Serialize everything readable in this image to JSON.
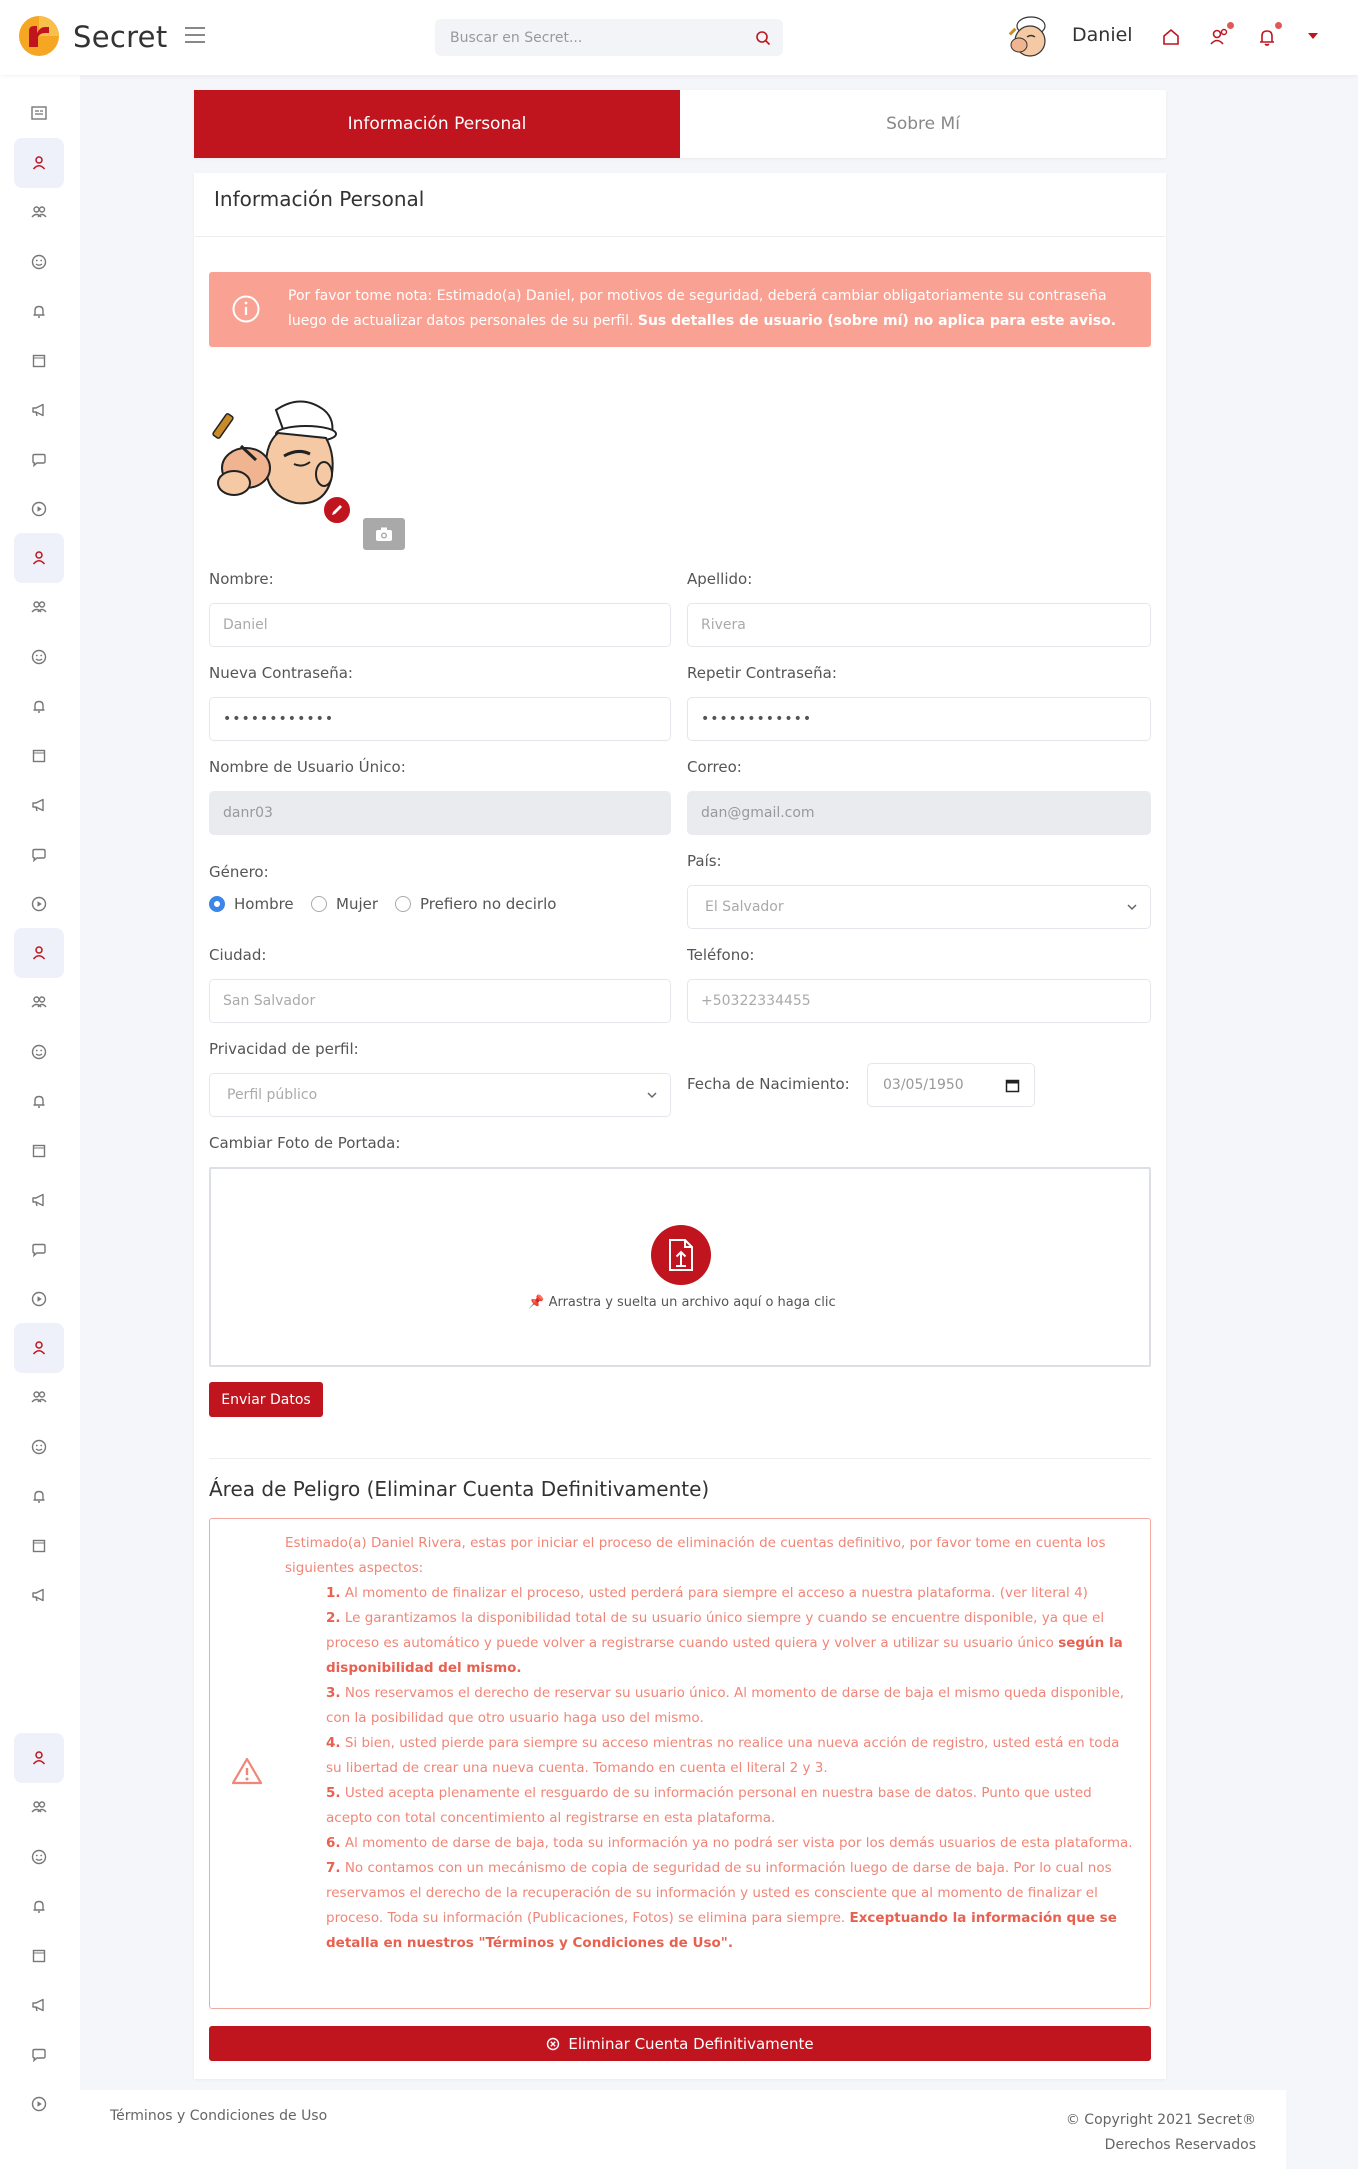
{
  "header": {
    "brand": "Secret",
    "search_placeholder": "Buscar en Secret...",
    "user_name": "Daniel"
  },
  "tabs": {
    "personal": "Información Personal",
    "about": "Sobre Mí"
  },
  "card": {
    "title": "Información Personal"
  },
  "alert": {
    "text": "Por favor tome nota: Estimado(a) Daniel, por motivos de seguridad, deberá cambiar obligatoriamente su contraseña luego de actualizar datos personales de su perfil.",
    "bold": "Sus detalles de usuario (sobre mí) no aplica para este aviso."
  },
  "form": {
    "nombre_label": "Nombre:",
    "nombre_value": "Daniel",
    "apellido_label": "Apellido:",
    "apellido_value": "Rivera",
    "nueva_pass_label": "Nueva Contraseña:",
    "nueva_pass_value": "••••••••••••",
    "repetir_pass_label": "Repetir Contraseña:",
    "repetir_pass_value": "••••••••••••",
    "usuario_label": "Nombre de Usuario Único:",
    "usuario_value": "danr03",
    "correo_label": "Correo:",
    "correo_value": "dan@gmail.com",
    "genero_label": "Género:",
    "genero_options": [
      "Hombre",
      "Mujer",
      "Prefiero no decirlo"
    ],
    "pais_label": "País:",
    "pais_value": "El Salvador",
    "ciudad_label": "Ciudad:",
    "ciudad_value": "San Salvador",
    "telefono_label": "Teléfono:",
    "telefono_value": "+50322334455",
    "privacidad_label": "Privacidad de perfil:",
    "privacidad_value": "Perfil público",
    "fecha_label": "Fecha de Nacimiento:",
    "fecha_value": "03/05/1950",
    "portada_label": "Cambiar Foto de Portada:",
    "dropzone_text": "Arrastra y suelta un archivo aquí o haga clic",
    "submit_label": "Enviar Datos"
  },
  "danger": {
    "title": "Área de Peligro (Eliminar Cuenta Definitivamente)",
    "intro": "Estimado(a) Daniel Rivera, estas por iniciar el proceso de eliminación de cuentas definitivo, por favor tome en cuenta los siguientes aspectos:",
    "items": [
      {
        "num": "1.",
        "text": "Al momento de finalizar el proceso, usted perderá para siempre el acceso a nuestra plataforma. (ver literal 4)",
        "bold": ""
      },
      {
        "num": "2.",
        "text": "Le garantizamos la disponibilidad total de su usuario único siempre y cuando se encuentre disponible, ya que el proceso es automático y puede volver a registrarse cuando usted quiera y volver a utilizar su usuario único",
        "bold": "según la disponibilidad del mismo."
      },
      {
        "num": "3.",
        "text": "Nos reservamos el derecho de reservar su usuario único. Al momento de darse de baja el mismo queda disponible, con la posibilidad que otro usuario haga uso del mismo.",
        "bold": ""
      },
      {
        "num": "4.",
        "text": "Si bien, usted pierde para siempre su acceso mientras no realice una nueva acción de registro, usted está en toda su libertad de crear una nueva cuenta. Tomando en cuenta el literal 2 y 3.",
        "bold": ""
      },
      {
        "num": "5.",
        "text": "Usted acepta plenamente el resguardo de su información personal en nuestra base de datos. Punto que usted acepto con total concentimiento al registrarse en esta plataforma.",
        "bold": ""
      },
      {
        "num": "6.",
        "text": "Al momento de darse de baja, toda su información ya no podrá ser vista por los demás usuarios de esta plataforma.",
        "bold": ""
      },
      {
        "num": "7.",
        "text": "No contamos con un mecánismo de copia de seguridad de su información luego de darse de baja. Por lo cual nos reservamos el derecho de la recuperación de su información y usted es consciente que al momento de finalizar el proceso. Toda su información (Publicaciones, Fotos) se elimina para siempre.",
        "bold": "Exceptuando la información que se detalla en nuestros \"Términos y Condiciones de Uso\"."
      }
    ],
    "delete_label": "Eliminar Cuenta Definitivamente"
  },
  "footer": {
    "terms": "Términos y Condiciones de Uso",
    "copyright": "© Copyright 2021 Secret®",
    "rights": "Derechos Reservados"
  },
  "colors": {
    "primary": "#c0141e",
    "alert_bg": "#f9a193",
    "danger_text": "#f18577",
    "radio_active": "#3b86e8"
  },
  "sidebar_icons": [
    "newspaper-icon",
    "user-icon",
    "users-icon",
    "smile-icon",
    "bell-icon",
    "square-icon",
    "megaphone-icon",
    "chat-icon",
    "play-icon"
  ]
}
